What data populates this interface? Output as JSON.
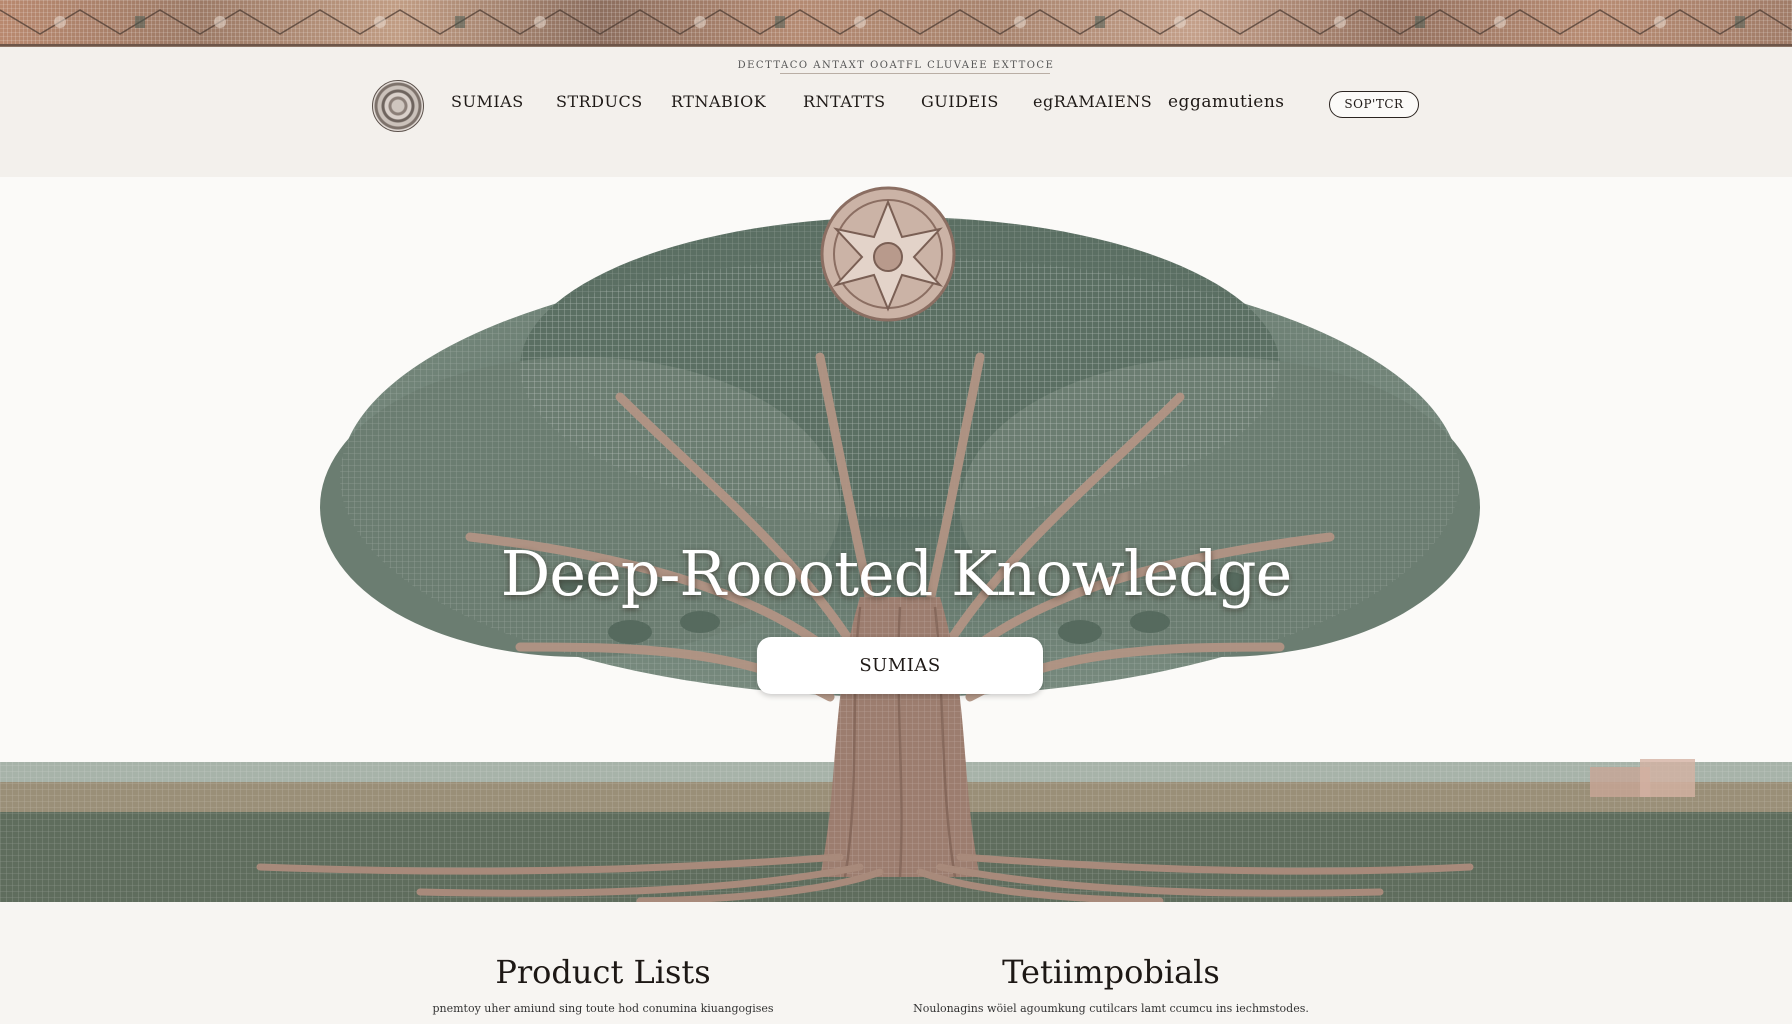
{
  "header": {
    "tagline": "DECTTACO ANTAXT OOATFL CLUVAEE EXTTOCE",
    "nav": [
      "SUMIAS",
      "STRDUCS",
      "RTNABIOK",
      "RNTATTS",
      "GUIDEIS",
      "egRAMAIENS",
      "eggamutiens"
    ],
    "cta_label": "SOP'TCR"
  },
  "hero": {
    "title": "Deep-Roooted Knowledge",
    "button_label": "SUMIAS"
  },
  "sections": [
    {
      "title": "Product Lists",
      "text": "pnemtoy uher amiund sing toute hod conumina kiuangogises"
    },
    {
      "title": "Tetiimpobials",
      "text": "Noulonagins wöiel agoumkung cutilcars lamt ccumcu ins iechmstodes."
    }
  ],
  "colors": {
    "foliage": "#5f7468",
    "trunk": "#9a7a6c",
    "ground": "#6f7a63",
    "background": "#fbfaf8"
  }
}
